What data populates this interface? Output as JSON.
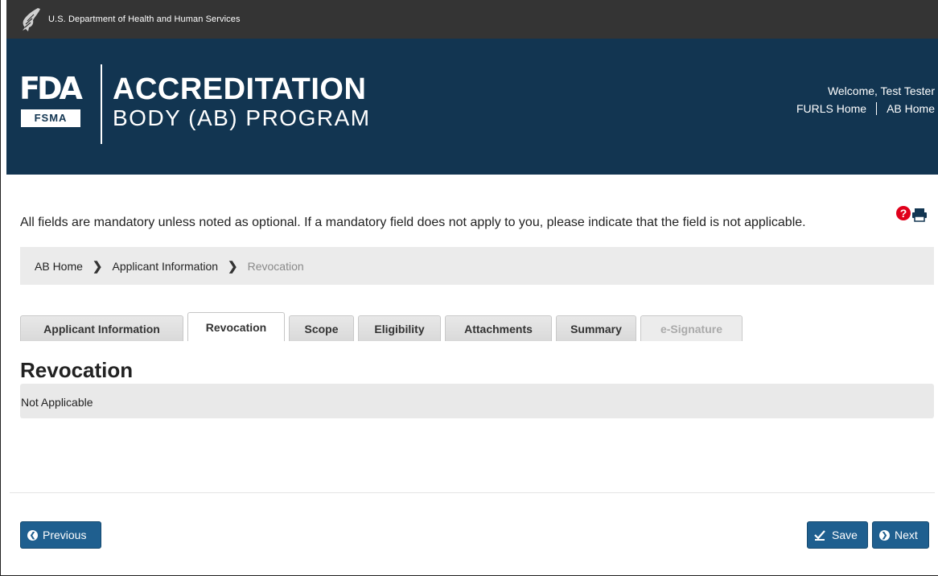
{
  "header": {
    "agency": "U.S. Department of Health and Human Services",
    "logo_fda": "FDA",
    "logo_fsma": "FSMA",
    "title_line1": "ACCREDITATION",
    "title_line2": "BODY (AB) PROGRAM",
    "welcome": "Welcome, Test Tester",
    "nav": {
      "furls_home": "FURLS Home",
      "ab_home": "AB Home"
    }
  },
  "instructions": "All fields are mandatory unless noted as optional. If a mandatory field does not apply to you, please indicate that the field is not applicable.",
  "breadcrumb": {
    "items": [
      "AB Home",
      "Applicant Information"
    ],
    "current": "Revocation"
  },
  "tabs": [
    {
      "label": "Applicant Information",
      "state": "normal"
    },
    {
      "label": "Revocation",
      "state": "active"
    },
    {
      "label": "Scope",
      "state": "normal"
    },
    {
      "label": "Eligibility",
      "state": "normal"
    },
    {
      "label": "Attachments",
      "state": "normal"
    },
    {
      "label": "Summary",
      "state": "normal"
    },
    {
      "label": "e-Signature",
      "state": "disabled"
    }
  ],
  "section": {
    "title": "Revocation",
    "content": "Not Applicable"
  },
  "buttons": {
    "previous": "Previous",
    "save": "Save",
    "next": "Next"
  },
  "icons": {
    "help": "question-circle-icon",
    "print": "printer-icon"
  },
  "colors": {
    "banner": "#123551",
    "top_bar": "#343434",
    "button": "#1f5f8f",
    "help": "#e0001b"
  }
}
